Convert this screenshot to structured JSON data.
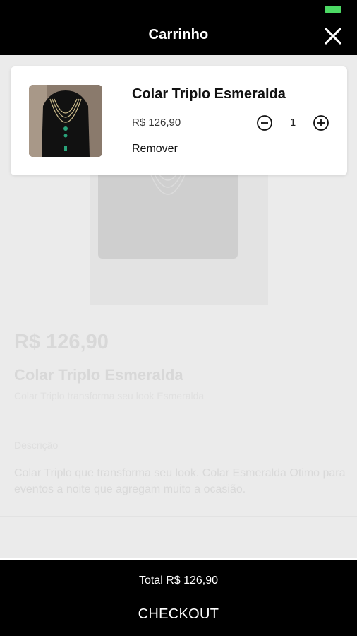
{
  "header": {
    "title": "Carrinho",
    "close_icon": "close-icon",
    "battery_color": "#4cd964"
  },
  "background_page": {
    "price": "R$ 126,90",
    "product_name": "Colar Triplo Esmeralda",
    "subtitle": "Colar Triplo transforma seu look Esmeralda",
    "section_label": "Descrição",
    "description": "Colar Triplo que transforma seu look. Colar Esmeralda Otimo para eventos a noite que agregam muito a ocasião."
  },
  "cart": {
    "items": [
      {
        "name": "Colar Triplo Esmeralda",
        "price": "R$ 126,90",
        "quantity": "1",
        "remove_label": "Remover",
        "image_icon": "necklace-photo"
      }
    ]
  },
  "footer": {
    "total_label": "Total R$ 126,90",
    "checkout_label": "CHECKOUT"
  }
}
